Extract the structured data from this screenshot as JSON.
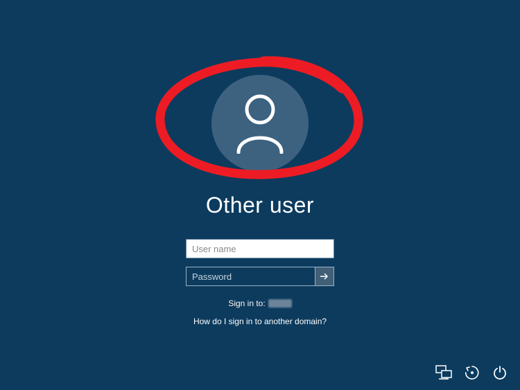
{
  "title": "Other user",
  "inputs": {
    "username_placeholder": "User name",
    "password_placeholder": "Password"
  },
  "links": {
    "sign_in_to_label": "Sign in to:",
    "another_domain": "How do I sign in to another domain?"
  },
  "icons": {
    "avatar": "user-avatar",
    "submit": "arrow-right",
    "network": "network",
    "ease_of_access": "ease-of-access",
    "power": "power"
  },
  "colors": {
    "background": "#0c3b5e",
    "avatar_bg": "#3d6280",
    "annotation": "#ed1c24"
  }
}
